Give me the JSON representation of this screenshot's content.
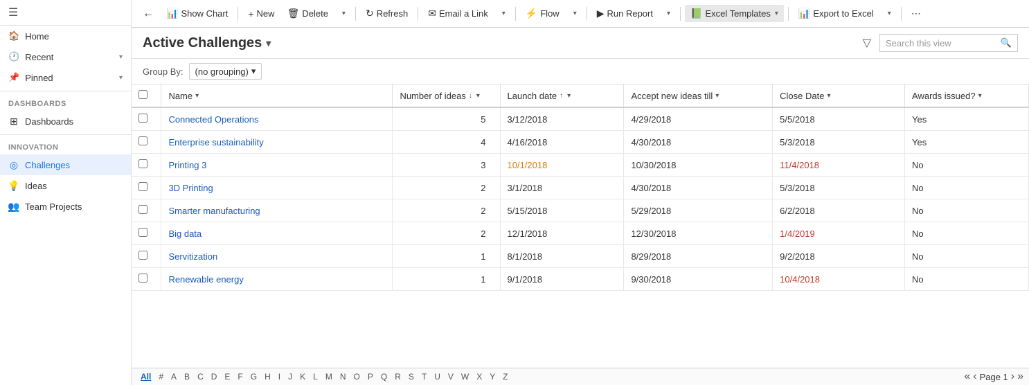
{
  "sidebar": {
    "hamburger": "☰",
    "nav_groups": [
      {
        "label": "Home",
        "icon": "🏠",
        "expandable": false
      },
      {
        "label": "Recent",
        "icon": "🕐",
        "expandable": true
      },
      {
        "label": "Pinned",
        "icon": "📌",
        "expandable": true
      }
    ],
    "sections": [
      {
        "title": "Dashboards",
        "items": [
          {
            "label": "Dashboards",
            "icon": "⊞"
          }
        ]
      },
      {
        "title": "Innovation",
        "items": [
          {
            "label": "Challenges",
            "icon": "◎",
            "active": true
          },
          {
            "label": "Ideas",
            "icon": "💡"
          },
          {
            "label": "Team Projects",
            "icon": "👥"
          }
        ]
      }
    ]
  },
  "toolbar": {
    "back_icon": "←",
    "show_chart_label": "Show Chart",
    "show_chart_icon": "📊",
    "new_label": "New",
    "new_icon": "+",
    "delete_label": "Delete",
    "delete_icon": "🗑",
    "more_icon": "▾",
    "refresh_label": "Refresh",
    "refresh_icon": "↻",
    "email_link_label": "Email a Link",
    "email_icon": "✉",
    "flow_label": "Flow",
    "flow_icon": "⚡",
    "run_report_label": "Run Report",
    "run_report_icon": "▶",
    "excel_templates_label": "Excel Templates",
    "excel_icon": "📗",
    "export_excel_label": "Export to Excel",
    "export_icon": "📊",
    "more_options_icon": "⋯"
  },
  "content_header": {
    "title": "Active Challenges",
    "title_chevron": "▾",
    "search_placeholder": "Search this view",
    "search_icon": "🔍",
    "filter_icon": "▽"
  },
  "groupby": {
    "label": "Group By:",
    "value": "(no grouping)",
    "chevron": "▾"
  },
  "table": {
    "columns": [
      {
        "key": "name",
        "label": "Name",
        "sort": "▾",
        "filter": ""
      },
      {
        "key": "ideas",
        "label": "Number of ideas",
        "sort": "↓",
        "filter": "▾"
      },
      {
        "key": "launch",
        "label": "Launch date",
        "sort": "↑",
        "filter": "▾"
      },
      {
        "key": "accept",
        "label": "Accept new ideas till",
        "sort": "▾",
        "filter": ""
      },
      {
        "key": "close",
        "label": "Close Date",
        "sort": "▾",
        "filter": ""
      },
      {
        "key": "awards",
        "label": "Awards issued?",
        "sort": "▾",
        "filter": ""
      }
    ],
    "rows": [
      {
        "name": "Connected Operations",
        "ideas": 5,
        "launch": "3/12/2018",
        "accept": "4/29/2018",
        "close": "5/5/2018",
        "awards": "Yes",
        "launch_color": "normal",
        "accept_color": "normal",
        "close_color": "normal"
      },
      {
        "name": "Enterprise sustainability",
        "ideas": 4,
        "launch": "4/16/2018",
        "accept": "4/30/2018",
        "close": "5/3/2018",
        "awards": "Yes",
        "launch_color": "normal",
        "accept_color": "normal",
        "close_color": "normal"
      },
      {
        "name": "Printing 3",
        "ideas": 3,
        "launch": "10/1/2018",
        "accept": "10/30/2018",
        "close": "11/4/2018",
        "awards": "No",
        "launch_color": "orange",
        "accept_color": "normal",
        "close_color": "red"
      },
      {
        "name": "3D Printing",
        "ideas": 2,
        "launch": "3/1/2018",
        "accept": "4/30/2018",
        "close": "5/3/2018",
        "awards": "No",
        "launch_color": "normal",
        "accept_color": "normal",
        "close_color": "normal"
      },
      {
        "name": "Smarter manufacturing",
        "ideas": 2,
        "launch": "5/15/2018",
        "accept": "5/29/2018",
        "close": "6/2/2018",
        "awards": "No",
        "launch_color": "normal",
        "accept_color": "normal",
        "close_color": "normal"
      },
      {
        "name": "Big data",
        "ideas": 2,
        "launch": "12/1/2018",
        "accept": "12/30/2018",
        "close": "1/4/2019",
        "awards": "No",
        "launch_color": "normal",
        "accept_color": "normal",
        "close_color": "red"
      },
      {
        "name": "Servitization",
        "ideas": 1,
        "launch": "8/1/2018",
        "accept": "8/29/2018",
        "close": "9/2/2018",
        "awards": "No",
        "launch_color": "normal",
        "accept_color": "normal",
        "close_color": "normal"
      },
      {
        "name": "Renewable energy",
        "ideas": 1,
        "launch": "9/1/2018",
        "accept": "9/30/2018",
        "close": "10/4/2018",
        "awards": "No",
        "launch_color": "normal",
        "accept_color": "normal",
        "close_color": "red"
      }
    ]
  },
  "pagination": {
    "page_label": "Page 1",
    "alpha": [
      "All",
      "#",
      "A",
      "B",
      "C",
      "D",
      "E",
      "F",
      "G",
      "H",
      "I",
      "J",
      "K",
      "L",
      "M",
      "N",
      "O",
      "P",
      "Q",
      "R",
      "S",
      "T",
      "U",
      "V",
      "W",
      "X",
      "Y",
      "Z"
    ],
    "prev_page": "‹",
    "next_page": "›",
    "first_page": "«",
    "last_page": "»"
  }
}
